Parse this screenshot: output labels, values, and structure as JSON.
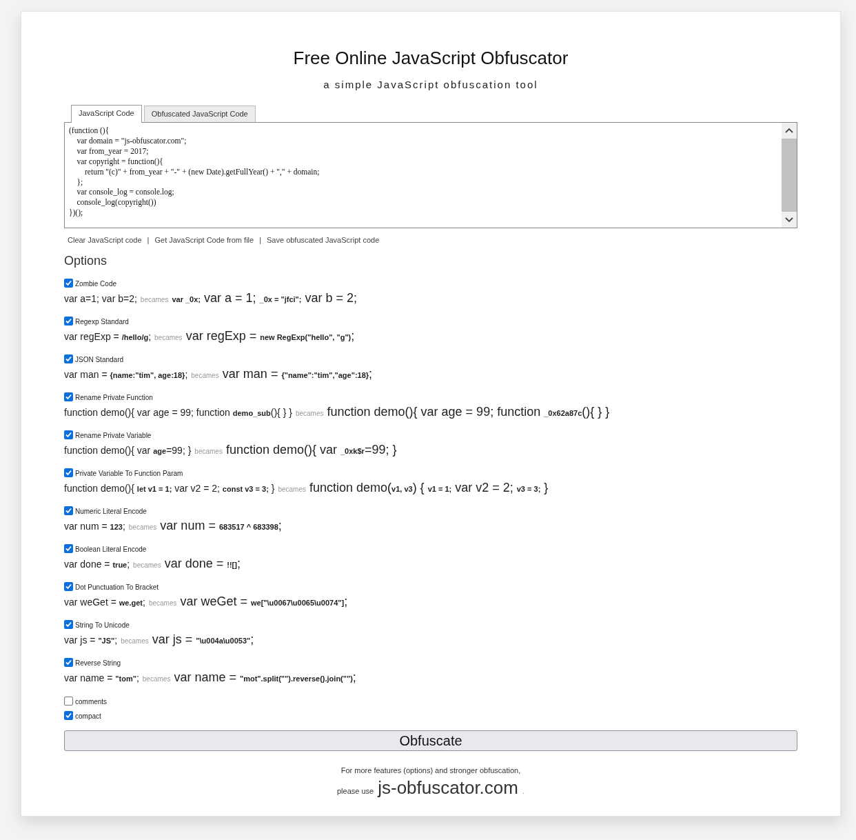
{
  "header": {
    "title": "Free Online JavaScript Obfuscator",
    "subtitle": "a simple JavaScript obfuscation tool"
  },
  "tabs": [
    {
      "label": "JavaScript Code",
      "selected": true
    },
    {
      "label": "Obfuscated JavaScript Code",
      "selected": false
    }
  ],
  "editor": {
    "code": "(function (){\n    var domain = \"js-obfuscator.com\";\n    var from_year = 2017;\n    var copyright = function(){\n        return \"(c)\" + from_year + \"-\" + (new Date).getFullYear() + \",\" + domain;\n    };\n    var console_log = console.log;\n    console_log(copyright())\n})();"
  },
  "links": [
    "Clear JavaScript code",
    "Get JavaScript Code from file",
    "Save obfuscated JavaScript code"
  ],
  "link_separator": "|",
  "options_heading": "Options",
  "options": [
    {
      "label": "Zombie Code",
      "checked": true,
      "before": "var a=1; var b=2;",
      "connector": "becames",
      "after": "**var _0x;** var a = 1; **_0x = \"jfci\";** var b = 2;"
    },
    {
      "label": "Regexp Standard",
      "checked": true,
      "before": "var regExp = **/hello/g**;",
      "connector": "becames",
      "after": "var regExp = **new RegExp(\"hello\", \"g\")**;"
    },
    {
      "label": "JSON Standard",
      "checked": true,
      "before": "var man = **{name:\"tim\", age:18}**;",
      "connector": "becames",
      "after": "var man = **{\"name\":\"tim\",\"age\":18}**;"
    },
    {
      "label": "Rename Private Function",
      "checked": true,
      "before": "function demo(){ var age = 99; function **demo_sub**(){ } }",
      "connector": "becames",
      "after": "function demo(){ var age = 99; function **_0x62a87c**(){ } }"
    },
    {
      "label": "Rename Private Variable",
      "checked": true,
      "before": "function demo(){ var **age**=99; }",
      "connector": "becames",
      "after": "function demo(){ var **_0xk$r**=99; }"
    },
    {
      "label": "Private Variable To Function Param",
      "checked": true,
      "before": "function demo(){ **let v1 = 1;** var v2 = 2; **const v3 = 3;** }",
      "connector": "becames",
      "after": "function demo(**v1, v3**) { **v1 = 1;** var v2 = 2; **v3 = 3;** }"
    },
    {
      "label": "Numeric Literal Encode",
      "checked": true,
      "before": "var num = **123**;",
      "connector": "becames",
      "after": "var num = **683517 ^ 683398**;"
    },
    {
      "label": "Boolean Literal Encode",
      "checked": true,
      "before": "var done = **true**;",
      "connector": "becames",
      "after": "var done = **!![]**;"
    },
    {
      "label": "Dot Punctuation To Bracket",
      "checked": true,
      "before": "var weGet = **we.get**;",
      "connector": "becames",
      "after": "var weGet = **we[\"\\u0067\\u0065\\u0074\"]**;"
    },
    {
      "label": "String To Unicode",
      "checked": true,
      "before": "var js = **\"JS\"**;",
      "connector": "becames",
      "after": "var js = **\"\\u004a\\u0053\"**;"
    },
    {
      "label": "Reverse String",
      "checked": true,
      "before": "var name = **\"tom\"**;",
      "connector": "becames",
      "after": "var name = **\"mot\".split(\"\").reverse().join(\"\")**;"
    },
    {
      "label": "comments",
      "checked": false
    },
    {
      "label": "compact",
      "checked": true
    }
  ],
  "button": "Obfuscate",
  "footer": {
    "note": "For more features (options) and stronger obfuscation,",
    "prefix": "please use",
    "link": "js-obfuscator.com",
    "suffix": "."
  }
}
